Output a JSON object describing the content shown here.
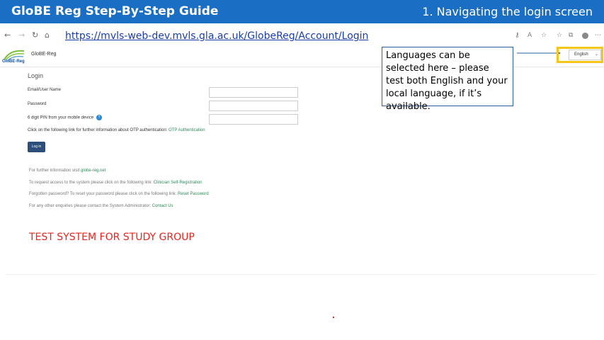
{
  "slide": {
    "title": "GloBE Reg Step-By-Step Guide",
    "subtitle": "1. Navigating the login screen",
    "callout": "Languages can be selected here – please test both English and your local language, if it’s available."
  },
  "browser": {
    "url": "https://mvls-web-dev.mvls.gla.ac.uk/GlobeReg/Account/Login"
  },
  "app": {
    "logo_text": "GloBE-Reg",
    "name": "GloBE-Reg",
    "language": "English"
  },
  "login": {
    "title": "Login",
    "email_label": "Email/User Name",
    "password_label": "Password",
    "pin_label": "6 digit PIN from your mobile device",
    "otp_text": "Click on the following link for further information about OTP authentication:",
    "otp_link": "OTP Authentication",
    "button_label": "Log in"
  },
  "info": {
    "further_text": "For further information visit",
    "further_link": "globe-reg.net",
    "request_text": "To request access to the system please click on the following link:",
    "request_link": "Clinician Self-Registration",
    "forgot_text": "Forgotten password? To reset your password please click on the following link:",
    "forgot_link": "Reset Password",
    "enquiries_text": "For any other enquiries please contact the System Administrator:",
    "enquiries_link": "Contact Us"
  },
  "banner": "TEST SYSTEM FOR STUDY GROUP",
  "colors": {
    "header_blue": "#1a6fc4",
    "highlight_yellow": "#f5c518",
    "banner_red": "#e8251e",
    "link_green": "#2e8b57",
    "button_navy": "#2d4e7a"
  }
}
